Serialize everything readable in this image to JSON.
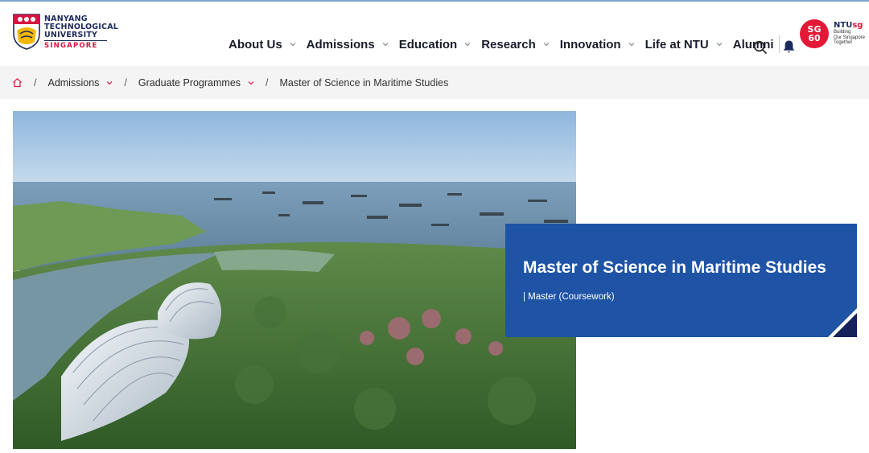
{
  "logo": {
    "lines": [
      "NANYANG",
      "TECHNOLOGICAL",
      "UNIVERSITY"
    ],
    "country": "SINGAPORE"
  },
  "nav": {
    "items": [
      {
        "label": "About Us",
        "has_dropdown": true
      },
      {
        "label": "Admissions",
        "has_dropdown": true
      },
      {
        "label": "Education",
        "has_dropdown": true
      },
      {
        "label": "Research",
        "has_dropdown": true
      },
      {
        "label": "Innovation",
        "has_dropdown": true
      },
      {
        "label": "Life at NTU",
        "has_dropdown": true
      },
      {
        "label": "Alumni",
        "has_dropdown": false
      }
    ],
    "search_icon": "search-icon",
    "notification_icon": "bell-icon"
  },
  "sg60": {
    "badge_top": "SG",
    "badge_bottom": "60",
    "brand_main": "NTU",
    "brand_accent": "sg",
    "tagline": [
      "Building",
      "Our Singapore",
      "Together"
    ]
  },
  "breadcrumb": {
    "home_icon": "home-icon",
    "items": [
      {
        "label": "Admissions",
        "has_dropdown": true
      },
      {
        "label": "Graduate Programmes",
        "has_dropdown": true
      },
      {
        "label": "Master of Science in Maritime Studies",
        "has_dropdown": false
      }
    ]
  },
  "hero": {
    "title": "Master of Science in Maritime Studies",
    "subtitle": "| Master (Coursework)"
  },
  "colors": {
    "brand_navy": "#1c2a5c",
    "brand_red": "#d71440",
    "card_blue": "#1e53a6",
    "fold_navy": "#16205a"
  }
}
